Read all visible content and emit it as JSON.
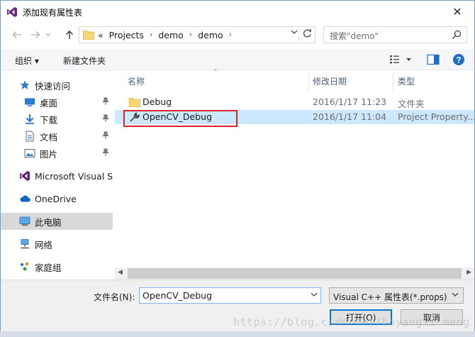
{
  "window": {
    "title": "添加现有属性表",
    "close_glyph": "✕"
  },
  "address": {
    "prefix": "«",
    "crumbs": [
      "Projects",
      "demo",
      "demo"
    ],
    "separator": "›"
  },
  "search": {
    "placeholder": "搜索\"demo\""
  },
  "toolbar": {
    "organize_label": "组织 ▾",
    "new_folder_label": "新建文件夹"
  },
  "sidebar": {
    "items": [
      {
        "label": "快速访问",
        "icon": "star-icon"
      },
      {
        "label": "桌面",
        "icon": "desktop-icon",
        "pinned": true
      },
      {
        "label": "下载",
        "icon": "download-icon",
        "pinned": true
      },
      {
        "label": "文档",
        "icon": "document-icon",
        "pinned": true
      },
      {
        "label": "图片",
        "icon": "picture-icon",
        "pinned": true
      },
      {
        "label": "Microsoft Visual Stu",
        "icon": "visual-studio-icon"
      },
      {
        "label": "OneDrive",
        "icon": "cloud-icon"
      },
      {
        "label": "此电脑",
        "icon": "computer-icon",
        "selected": true
      },
      {
        "label": "网络",
        "icon": "network-icon"
      },
      {
        "label": "家庭组",
        "icon": "homegroup-icon"
      }
    ]
  },
  "columns": {
    "name": "名称",
    "date": "修改日期",
    "type": "类型"
  },
  "files": [
    {
      "name": "Debug",
      "date": "2016/1/17 11:23",
      "type": "文件夹",
      "icon": "folder-icon"
    },
    {
      "name": "OpenCV_Debug",
      "date": "2016/1/17 11:04",
      "type": "Project Property...",
      "icon": "wrench-icon",
      "selected": true
    }
  ],
  "footer": {
    "filename_label": "文件名(N):",
    "filename_value": "OpenCV_Debug",
    "filetype_value": "Visual C++ 属性表(*.props)",
    "open_label": "打开(O)",
    "cancel_label": "取消"
  },
  "watermark": "https://blog.csdn.net/boyangli_meng",
  "colors": {
    "accent": "#0078d7",
    "selection": "#cce8ff",
    "highlight_box": "#d9262b"
  }
}
